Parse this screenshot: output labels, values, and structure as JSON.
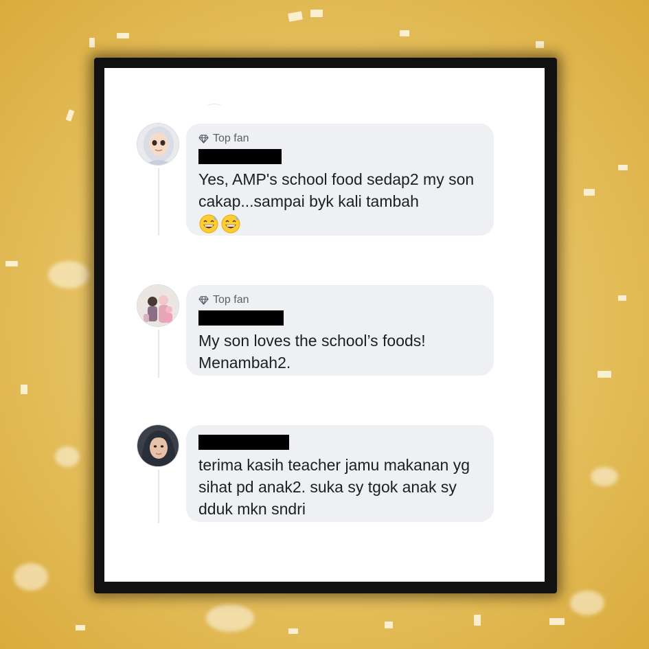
{
  "comments": [
    {
      "badge": "Top fan",
      "text": "Yes, AMP's school food sedap2 my son cakap...sampai byk kali tambah",
      "emojis": [
        "grinning-sweat-emoji",
        "grinning-sweat-emoji"
      ]
    },
    {
      "badge": "Top fan",
      "text": "My son loves the school’s foods! Menambah2."
    },
    {
      "text": "terima kasih teacher jamu makanan yg sihat pd anak2. suka sy tgok anak sy dduk mkn sndri"
    }
  ],
  "icons": {
    "badge": "diamond-icon"
  },
  "colors": {
    "bubble": "#eef0f4",
    "text": "#1c1e21",
    "badge_text": "#5b5f66",
    "background": "#e8c466"
  }
}
